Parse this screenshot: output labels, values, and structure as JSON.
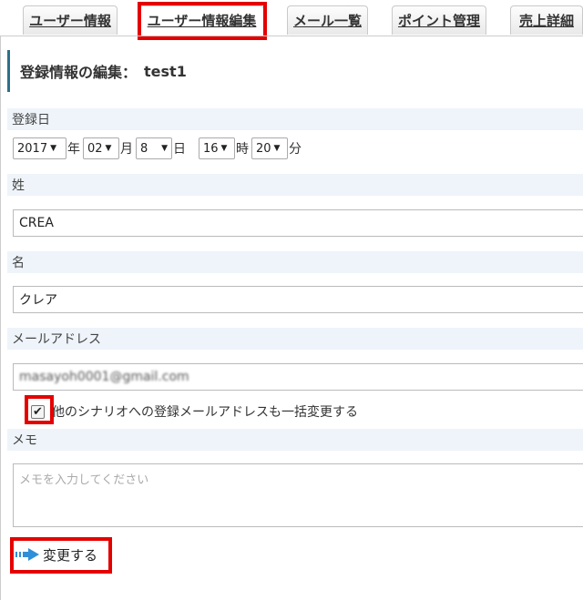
{
  "tabs": [
    {
      "label": "ユーザー情報"
    },
    {
      "label": "ユーザー情報編集"
    },
    {
      "label": "メール一覧"
    },
    {
      "label": "ポイント管理"
    },
    {
      "label": "売上詳細"
    }
  ],
  "page": {
    "title_prefix": "登録情報の編集：",
    "username": "test1"
  },
  "form": {
    "reg_date": {
      "label": "登録日",
      "year": "2017",
      "year_unit": "年",
      "month": "02",
      "month_unit": "月",
      "day": "8",
      "day_unit": "日",
      "hour": "16",
      "hour_unit": "時",
      "minute": "20",
      "minute_unit": "分"
    },
    "last_name": {
      "label": "姓",
      "value": "CREA"
    },
    "first_name": {
      "label": "名",
      "value": "クレア"
    },
    "email": {
      "label": "メールアドレス",
      "value": "masayoh0001@gmail.com"
    },
    "bulk_change": {
      "label": "他のシナリオへの登録メールアドレスも一括変更する",
      "checked": true
    },
    "memo": {
      "label": "メモ",
      "placeholder": "メモを入力してください",
      "value": ""
    },
    "submit_label": "変更する"
  },
  "colors": {
    "highlight": "#e50000",
    "accent": "#2e6f8a",
    "label_bg": "#eef4fa",
    "arrow": "#2f8fd8"
  }
}
